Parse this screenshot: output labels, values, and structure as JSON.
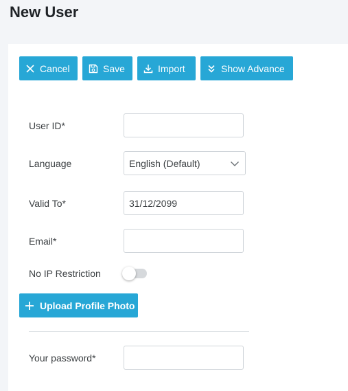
{
  "page": {
    "title": "New User"
  },
  "toolbar": {
    "cancel_label": "Cancel",
    "save_label": "Save",
    "import_label": "Import",
    "advance_label": "Show Advance"
  },
  "form": {
    "user_id": {
      "label": "User ID*",
      "value": ""
    },
    "language": {
      "label": "Language",
      "value": "English (Default)"
    },
    "valid_to": {
      "label": "Valid To*",
      "value": "31/12/2099"
    },
    "email": {
      "label": "Email*",
      "value": ""
    },
    "no_ip_restriction": {
      "label": "No IP Restriction",
      "enabled": false
    },
    "upload_label": "Upload Profile Photo",
    "password": {
      "label": "Your password*",
      "value": ""
    }
  },
  "colors": {
    "accent": "#27a7d6",
    "page_bg": "#f3f5f8"
  },
  "icons": {
    "cancel": "close-icon",
    "save": "floppy-disk-icon",
    "import": "download-icon",
    "advance": "double-chevron-down-icon",
    "language": "chevron-down-icon",
    "upload": "plus-icon"
  }
}
